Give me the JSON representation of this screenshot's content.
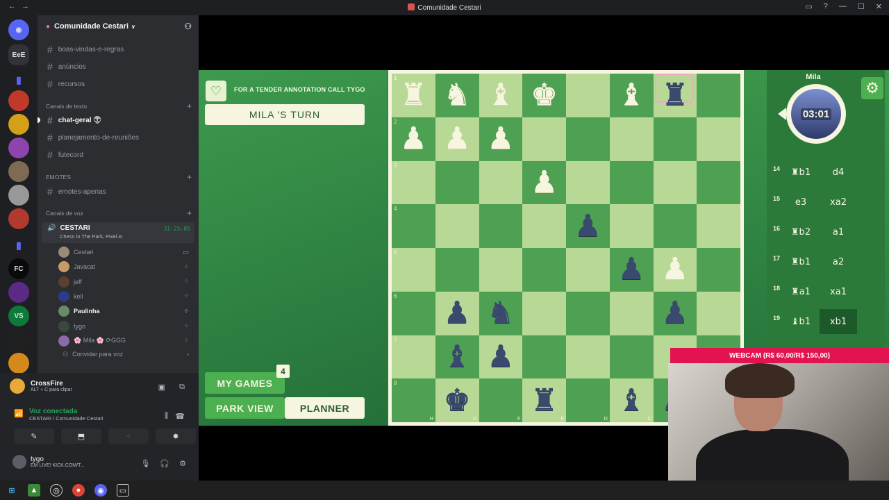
{
  "window": {
    "title": "Comunidade Cestari"
  },
  "servers": [
    {
      "label": "",
      "color": "#5865f2",
      "icon": "discord-icon"
    },
    {
      "label": "EeE",
      "color": "#313338"
    },
    {
      "label": "",
      "color": "#1e1f22",
      "icon": "folder-icon"
    },
    {
      "label": "",
      "color": "#c0392b"
    },
    {
      "label": "",
      "color": "#d4a017"
    },
    {
      "label": "",
      "color": "#8e44ad"
    },
    {
      "label": "",
      "color": "#7f6a54"
    },
    {
      "label": "",
      "color": "#999999"
    },
    {
      "label": "",
      "color": "#b03a2e"
    },
    {
      "label": "",
      "color": "#1e1f22",
      "icon": "folder-icon"
    },
    {
      "label": "FC",
      "color": "#0a0a0a"
    },
    {
      "label": "",
      "color": "#5b2a86"
    },
    {
      "label": "VS",
      "color": "#0e7a3a"
    },
    {
      "label": "",
      "color": "#202020"
    },
    {
      "label": "",
      "color": "#d48a1a"
    }
  ],
  "guild": {
    "name": "Comunidade Cestari"
  },
  "channels": {
    "top": [
      "boas-vindas-e-regras",
      "anúncios",
      "recursos"
    ],
    "text_category": "Canais de texto",
    "text": [
      "chat-geral 👽",
      "planejamento-de-reuniões",
      "futecord"
    ],
    "emotes_category": "EMOTES",
    "emotes": [
      "emotes-apenas"
    ],
    "voice_category": "Canais de voz",
    "voice_channel": {
      "name": "CESTARI",
      "time": "31:25:05",
      "activity": "Chess In The Park, Pixel.io"
    },
    "voice_users": [
      {
        "name": "Cestari",
        "bright": false,
        "color": "#9a8a7a"
      },
      {
        "name": "Javacat",
        "bright": false,
        "color": "#c79a6a"
      },
      {
        "name": "jeff",
        "bright": false,
        "color": "#5a4030"
      },
      {
        "name": "kell",
        "bright": false,
        "color": "#2e3a8a"
      },
      {
        "name": "Paulinha",
        "bright": true,
        "color": "#6a8a6a"
      },
      {
        "name": "tygo",
        "bright": false,
        "color": "#3a4a3a"
      },
      {
        "name": "🌸 Mila 🌸 ⟳GGG",
        "bright": false,
        "color": "#8a6aa8"
      }
    ],
    "invite": "Convidar para voz"
  },
  "activity_user": {
    "name": "CrossFire",
    "shortcut": "ALT + C para clipar"
  },
  "voice_status": {
    "title": "Voz conectada",
    "subtitle": "CESTARI / Comunidade Cestari"
  },
  "me": {
    "name": "tygo",
    "status": "EM LIVE! KICK.COM/T..."
  },
  "game": {
    "banner": "FOR A TENDER ANNOTATION CALL TYGO",
    "turn": "MILA 'S TURN",
    "my_games": "MY GAMES",
    "my_games_count": "4",
    "park_view": "PARK VIEW",
    "planner": "PLANNER",
    "opponent": "Mila",
    "clock": "03:01",
    "ranks": [
      "1",
      "2",
      "3",
      "4",
      "5",
      "6",
      "7",
      "8"
    ],
    "files": [
      "H",
      "G",
      "F",
      "E",
      "D",
      "C",
      "B",
      "A"
    ],
    "board": [
      [
        "wR",
        "wN",
        "wB",
        "wK",
        "",
        "wB",
        "bR",
        ""
      ],
      [
        "wP",
        "wP",
        "wP",
        "",
        "",
        "",
        "",
        ""
      ],
      [
        "",
        "",
        "",
        "wP",
        "",
        "",
        "",
        ""
      ],
      [
        "",
        "",
        "",
        "",
        "bP",
        "",
        "",
        ""
      ],
      [
        "",
        "",
        "",
        "",
        "",
        "bP",
        "wP",
        ""
      ],
      [
        "",
        "bP",
        "bN",
        "",
        "",
        "",
        "bP",
        ""
      ],
      [
        "",
        "bB",
        "bP",
        "",
        "",
        "",
        "",
        ""
      ],
      [
        "",
        "bK",
        "",
        "bR",
        "",
        "bB",
        "bP",
        ""
      ]
    ],
    "moves": [
      {
        "num": "14",
        "a": "♜b1",
        "b": "d4",
        "sel": ""
      },
      {
        "num": "15",
        "a": "e3",
        "b": "xa2",
        "sel": ""
      },
      {
        "num": "16",
        "a": "♜b2",
        "b": "a1",
        "sel": ""
      },
      {
        "num": "17",
        "a": "♜b1",
        "b": "a2",
        "sel": ""
      },
      {
        "num": "18",
        "a": "♜a1",
        "b": "xa1",
        "sel": ""
      },
      {
        "num": "19",
        "a": "♝b1",
        "b": "xb1",
        "sel": "b"
      }
    ]
  },
  "webcam": {
    "label": "WEBCAM (R$ 60,00/R$ 150,00)"
  }
}
